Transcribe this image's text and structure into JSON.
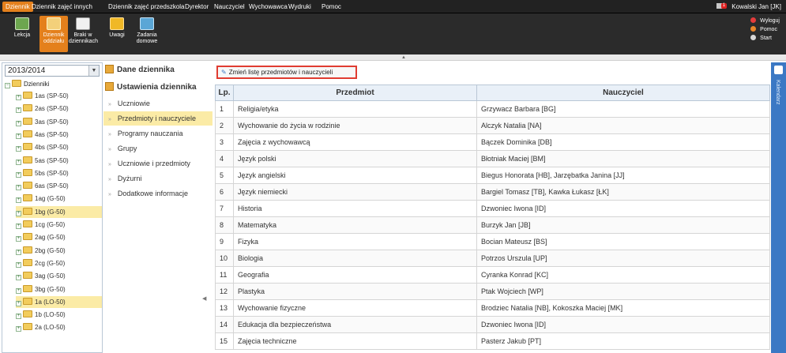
{
  "top_menu": {
    "items": [
      {
        "label": "Dziennik",
        "active": true
      },
      {
        "label": "Dziennik zajęć innych",
        "active": false
      },
      {
        "label": "Dziennik zajęć przedszkola",
        "active": false
      },
      {
        "label": "Dyrektor",
        "active": false
      },
      {
        "label": "Nauczyciel",
        "active": false
      },
      {
        "label": "Wychowawca",
        "active": false
      },
      {
        "label": "Wydruki",
        "active": false
      },
      {
        "label": "Pomoc",
        "active": false
      }
    ],
    "mail_badge": "1",
    "user": "Kowalski Jan [JK]",
    "accent_color": "#e4801c"
  },
  "ribbon": {
    "buttons": [
      {
        "label1": "Lekcja",
        "label2": "",
        "icon": "lesson-icon",
        "active": false
      },
      {
        "label1": "Dziennik",
        "label2": "oddziału",
        "icon": "journal-icon",
        "active": true
      },
      {
        "label1": "Braki w",
        "label2": "dziennikach",
        "icon": "missing-icon",
        "active": false
      },
      {
        "label1": "Uwagi",
        "label2": "",
        "icon": "remarks-icon",
        "active": false
      },
      {
        "label1": "Zadania",
        "label2": "domowe",
        "icon": "homework-icon",
        "active": false
      }
    ],
    "right_links": [
      {
        "label": "Wyloguj",
        "icon": "logout-icon"
      },
      {
        "label": "Pomoc",
        "icon": "help-icon"
      },
      {
        "label": "Start",
        "icon": "start-icon"
      }
    ]
  },
  "tree": {
    "year": "2013/2014",
    "root": "Dzienniki",
    "items": [
      {
        "label": "1as (SP-50)",
        "selected": false
      },
      {
        "label": "2as (SP-50)",
        "selected": false
      },
      {
        "label": "3as (SP-50)",
        "selected": false
      },
      {
        "label": "4as (SP-50)",
        "selected": false
      },
      {
        "label": "4bs (SP-50)",
        "selected": false
      },
      {
        "label": "5as (SP-50)",
        "selected": false
      },
      {
        "label": "5bs (SP-50)",
        "selected": false
      },
      {
        "label": "6as (SP-50)",
        "selected": false
      },
      {
        "label": "1ag (G-50)",
        "selected": false
      },
      {
        "label": "1bg (G-50)",
        "selected": true
      },
      {
        "label": "1cg (G-50)",
        "selected": false
      },
      {
        "label": "2ag (G-50)",
        "selected": false
      },
      {
        "label": "2bg (G-50)",
        "selected": false
      },
      {
        "label": "2cg (G-50)",
        "selected": false
      },
      {
        "label": "3ag (G-50)",
        "selected": false
      },
      {
        "label": "3bg (G-50)",
        "selected": false
      },
      {
        "label": "1a (LO-50)",
        "selected": true
      },
      {
        "label": "1b (LO-50)",
        "selected": false
      },
      {
        "label": "2a (LO-50)",
        "selected": false
      }
    ]
  },
  "side_menu": {
    "header1": "Dane dziennika",
    "header2": "Ustawienia dziennika",
    "items": [
      {
        "label": "Uczniowie",
        "active": false
      },
      {
        "label": "Przedmioty i nauczyciele",
        "active": true
      },
      {
        "label": "Programy nauczania",
        "active": false
      },
      {
        "label": "Grupy",
        "active": false
      },
      {
        "label": "Uczniowie i przedmioty",
        "active": false
      },
      {
        "label": "Dyżurni",
        "active": false
      },
      {
        "label": "Dodatkowe informacje",
        "active": false
      }
    ]
  },
  "main": {
    "change_button": "Zmień listę przedmiotów i nauczycieli",
    "columns": [
      "Lp.",
      "Przedmiot",
      "Nauczyciel"
    ],
    "rows": [
      [
        "1",
        "Religia/etyka",
        "Grzywacz Barbara [BG]"
      ],
      [
        "2",
        "Wychowanie do życia w rodzinie",
        "Alczyk Natalia [NA]"
      ],
      [
        "3",
        "Zajęcia z wychowawcą",
        "Bączek Dominika [DB]"
      ],
      [
        "4",
        "Język polski",
        "Błotniak Maciej [BM]"
      ],
      [
        "5",
        "Język angielski",
        "Biegus Honorata [HB], Jarzębatka Janina [JJ]"
      ],
      [
        "6",
        "Język niemiecki",
        "Bargiel Tomasz [TB], Kawka Łukasz [ŁK]"
      ],
      [
        "7",
        "Historia",
        "Dzwoniec Iwona [ID]"
      ],
      [
        "8",
        "Matematyka",
        "Burzyk Jan [JB]"
      ],
      [
        "9",
        "Fizyka",
        "Bocian Mateusz [BS]"
      ],
      [
        "10",
        "Biologia",
        "Potrzos Urszula [UP]"
      ],
      [
        "11",
        "Geografia",
        "Cyranka Konrad [KC]"
      ],
      [
        "12",
        "Plastyka",
        "Ptak Wojciech [WP]"
      ],
      [
        "13",
        "Wychowanie fizyczne",
        "Brodziec Natalia [NB], Kokoszka Maciej [MK]"
      ],
      [
        "14",
        "Edukacja dla bezpieczeństwa",
        "Dzwoniec Iwona [ID]"
      ],
      [
        "15",
        "Zajęcia techniczne",
        "Pasterz Jakub [PT]"
      ]
    ]
  },
  "right_panel": {
    "label": "Kalendarz"
  }
}
